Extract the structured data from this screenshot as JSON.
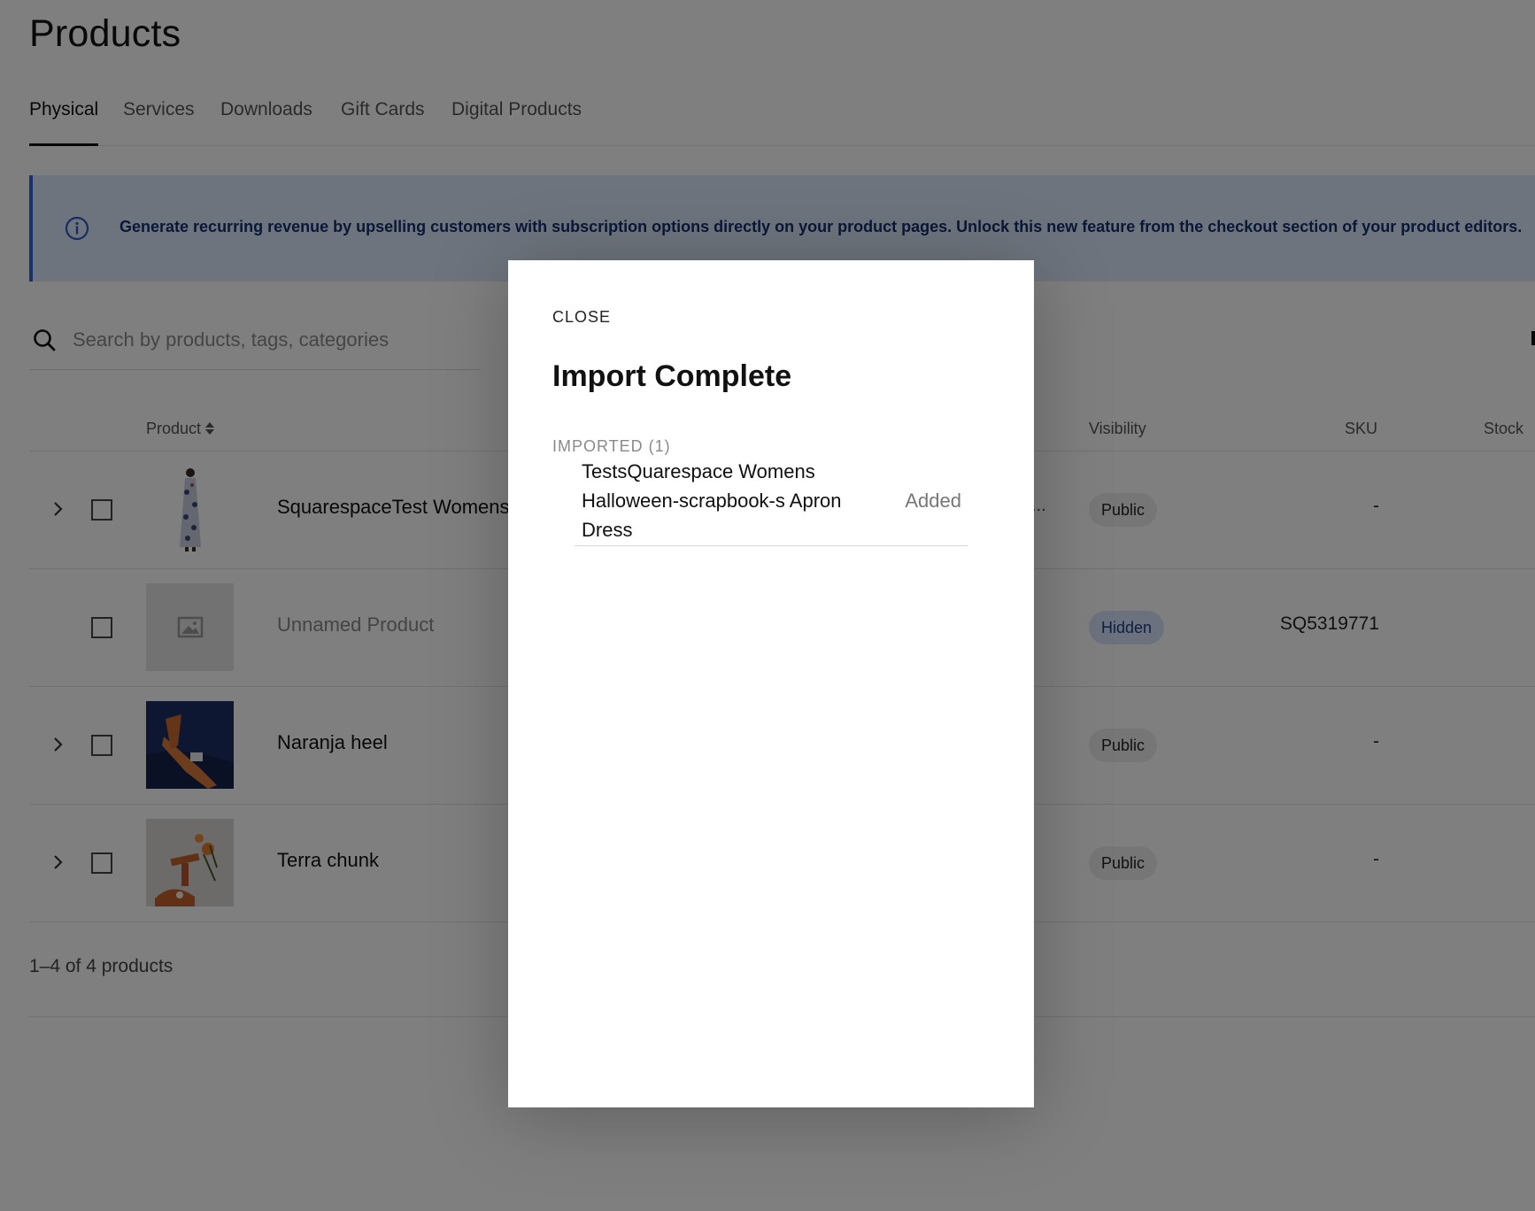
{
  "page": {
    "title": "Products"
  },
  "tabs": [
    {
      "label": "Physical",
      "active": true
    },
    {
      "label": "Services"
    },
    {
      "label": "Downloads"
    },
    {
      "label": "Gift Cards"
    },
    {
      "label": "Digital Products"
    }
  ],
  "banner": {
    "icon": "info-icon",
    "text": "Generate recurring revenue by upselling customers with subscription options directly on your product pages. Unlock this new feature from the checkout section of your product editors."
  },
  "search": {
    "placeholder": "Search by products, tags, categories",
    "value": ""
  },
  "table": {
    "headers": {
      "product": "Product",
      "visibility": "Visibility",
      "sku": "SKU",
      "stock": "Stock"
    },
    "rows": [
      {
        "name": "SquarespaceTest Womens",
        "visibility": "Public",
        "sku": "-",
        "thumb": "dress-photo",
        "expandable": true,
        "ellipsis": "..."
      },
      {
        "name": "Unnamed Product",
        "visibility": "Hidden",
        "sku": "SQ5319771",
        "thumb": "image-placeholder-icon",
        "expandable": false
      },
      {
        "name": "Naranja heel",
        "visibility": "Public",
        "sku": "-",
        "thumb": "heel-photo",
        "expandable": true
      },
      {
        "name": "Terra chunk",
        "visibility": "Public",
        "sku": "-",
        "thumb": "terra-photo",
        "expandable": true
      }
    ]
  },
  "pagination": {
    "count_text": "1–4 of 4 products"
  },
  "modal": {
    "close_label": "CLOSE",
    "title": "Import Complete",
    "section_label": "IMPORTED (1)",
    "items": [
      {
        "name": "TestsQuarespace Womens Halloween-scrapbook-s Apron Dress",
        "status": "Added"
      }
    ]
  },
  "colors": {
    "banner_bg": "#dce9fb",
    "banner_accent": "#2d66d6",
    "hidden_badge": "#d6e4fa",
    "overlay": "rgba(0,0,0,0.5)"
  }
}
